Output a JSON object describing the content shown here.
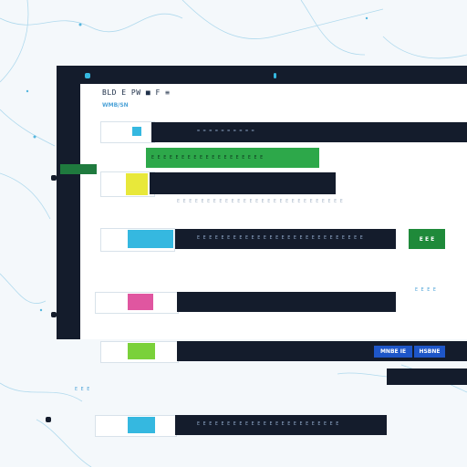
{
  "window": {
    "header_title": "BLD E PW ■ F ≡",
    "header_sub": "WMB/SN"
  },
  "rows": [
    {
      "label": "",
      "text": "=  =  =  =  =  =  =  =  =  =",
      "accent": "#35b8e0",
      "tag_color": "#2e8b57"
    },
    {
      "label": "",
      "text": "E E E E E E E E E E E E E E E E E E E",
      "accent": "#2da84a",
      "tag_color": "#2da84a"
    },
    {
      "label": "",
      "text": "",
      "accent": "#e8e83a",
      "tag_color": "#e8e83a"
    },
    {
      "label": "",
      "text": "E E E E E E E E E E E E E E E E E E E E E E E E E E E E",
      "accent": "#35b8e0",
      "tag_color": "#35b8e0"
    },
    {
      "label": "",
      "text": "",
      "accent": "#e056a0",
      "tag_color": "#e056a0"
    },
    {
      "label": "",
      "text": "",
      "accent": "#7ad13a",
      "tag_color": "#7ad13a"
    },
    {
      "label": "",
      "text": "E E E E E E E E E E E E E E E E E E E E E E E E",
      "accent": "#35b8e0",
      "tag_color": "#35b8e0"
    }
  ],
  "badges": {
    "green_badge": "E E E",
    "blue_badge_1": "MNBE IE",
    "blue_badge_2": "HSBNE"
  },
  "side_labels": {
    "bottom_left": "E E E",
    "mid_right": "E E E E"
  },
  "colors": {
    "frame": "#141c2c",
    "accent_blue": "#35b8e0",
    "accent_green": "#2da84a",
    "badge_blue": "#1e56c8"
  }
}
